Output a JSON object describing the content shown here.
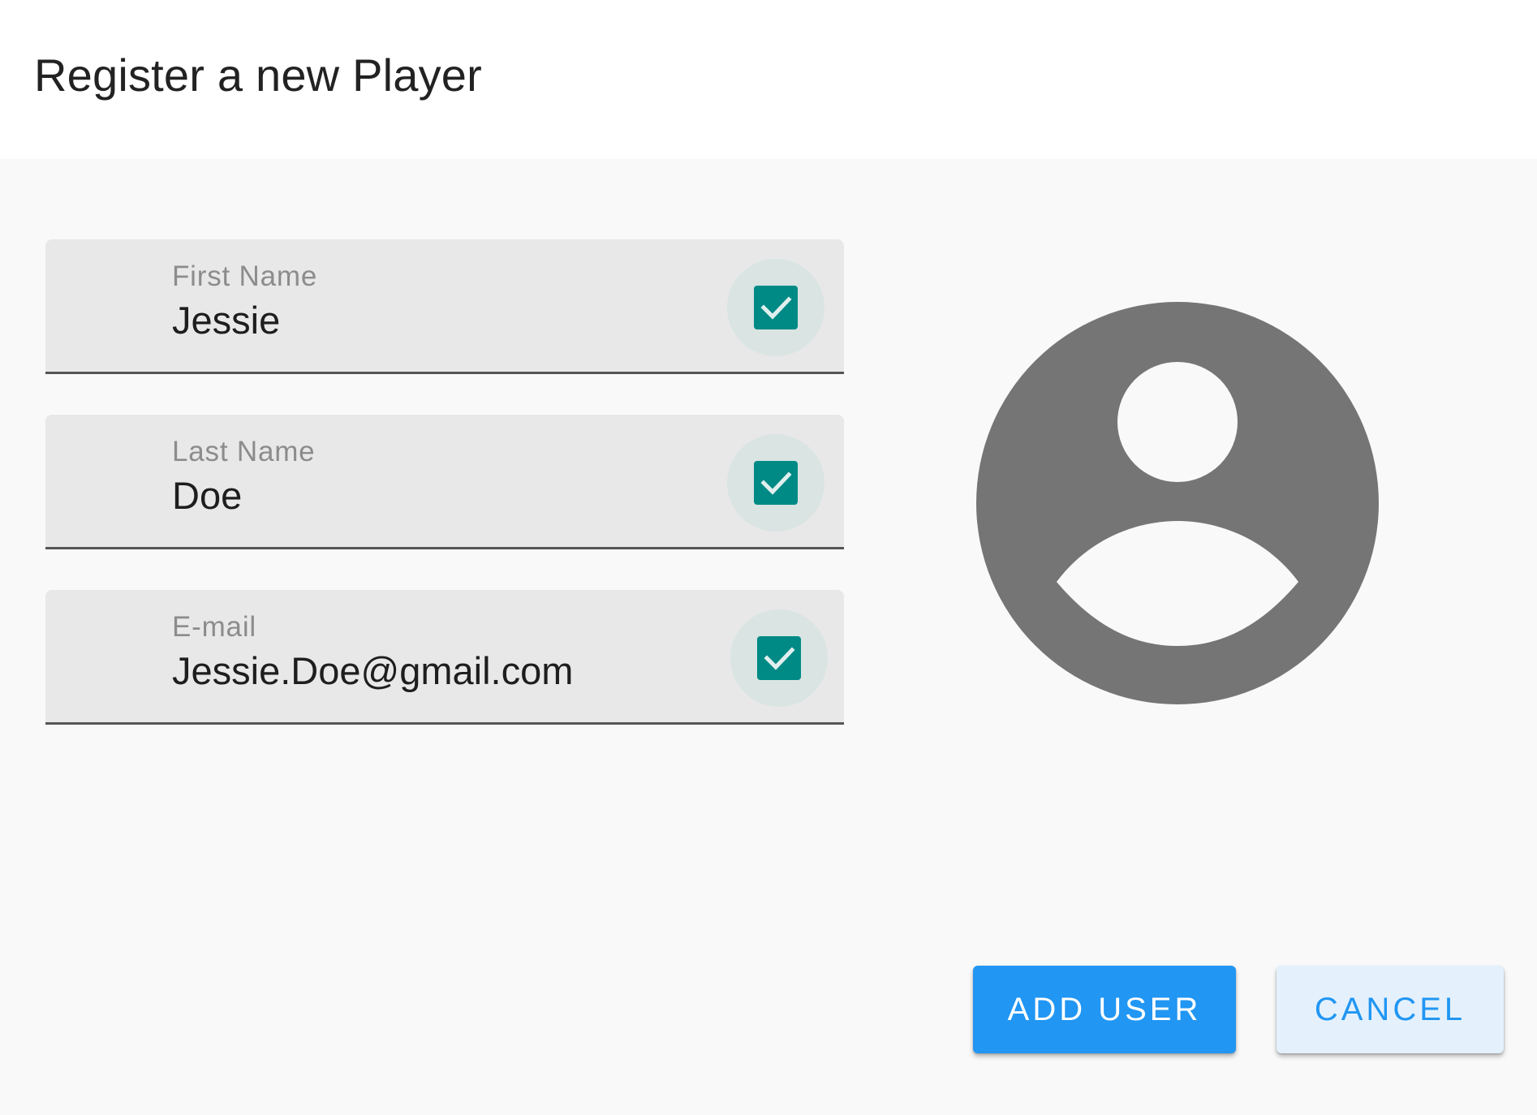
{
  "dialog": {
    "title": "Register a new Player"
  },
  "fields": [
    {
      "label": "First Name",
      "value": "Jessie",
      "valid": true
    },
    {
      "label": "Last Name",
      "value": "Doe",
      "valid": true
    },
    {
      "label": "E-mail",
      "value": "Jessie.Doe@gmail.com",
      "valid": true
    }
  ],
  "avatar": {
    "icon": "account-circle-icon",
    "color": "#757575"
  },
  "actions": {
    "add_label": "ADD USER",
    "cancel_label": "CANCEL"
  },
  "colors": {
    "primary": "#2196f3",
    "check": "#008a85",
    "field_bg": "#e8e8e8"
  }
}
